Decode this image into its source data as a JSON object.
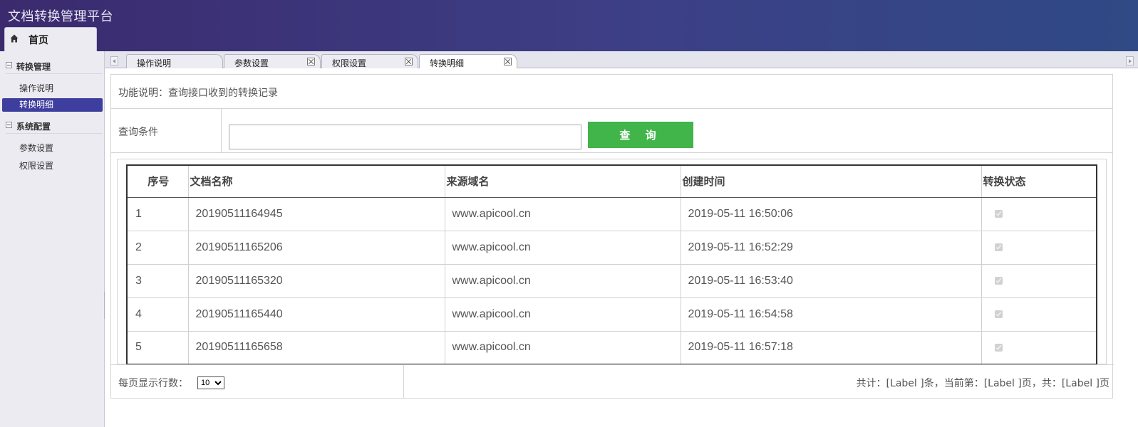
{
  "app": {
    "title": "文档转换管理平台"
  },
  "home_tab": {
    "label": "首页",
    "icon": "home-icon"
  },
  "sidebar": {
    "groups": [
      {
        "label": "转换管理",
        "items": [
          {
            "label": "操作说明"
          },
          {
            "label": "转换明细",
            "active": true
          }
        ]
      },
      {
        "label": "系统配置",
        "items": [
          {
            "label": "参数设置"
          },
          {
            "label": "权限设置"
          }
        ]
      }
    ]
  },
  "tabs": [
    {
      "label": "操作说明",
      "closable": false
    },
    {
      "label": "参数设置",
      "closable": true
    },
    {
      "label": "权限设置",
      "closable": true
    },
    {
      "label": "转换明细",
      "closable": true,
      "active": true
    }
  ],
  "page": {
    "description": "功能说明：查询接口收到的转换记录",
    "query_label": "查询条件",
    "query_value": "",
    "query_button": "查 询"
  },
  "table": {
    "columns": [
      "序号",
      "文档名称",
      "来源域名",
      "创建时间",
      "转换状态"
    ],
    "rows": [
      {
        "no": "1",
        "name": "20190511164945",
        "domain": "www.apicool.cn",
        "created": "2019-05-11 16:50:06",
        "status": true
      },
      {
        "no": "2",
        "name": "20190511165206",
        "domain": "www.apicool.cn",
        "created": "2019-05-11 16:52:29",
        "status": true
      },
      {
        "no": "3",
        "name": "20190511165320",
        "domain": "www.apicool.cn",
        "created": "2019-05-11 16:53:40",
        "status": true
      },
      {
        "no": "4",
        "name": "20190511165440",
        "domain": "www.apicool.cn",
        "created": "2019-05-11 16:54:58",
        "status": true
      },
      {
        "no": "5",
        "name": "20190511165658",
        "domain": "www.apicool.cn",
        "created": "2019-05-11 16:57:18",
        "status": true
      }
    ]
  },
  "pager": {
    "rows_label": "每页显示行数：",
    "page_size": "10",
    "summary": "共计：[Label ]条，当前第：[Label ]页，共：[Label ]页"
  },
  "colors": {
    "header": "#3b2a6e",
    "active_nav": "#3e3e9e",
    "query_button": "#41b44a"
  }
}
